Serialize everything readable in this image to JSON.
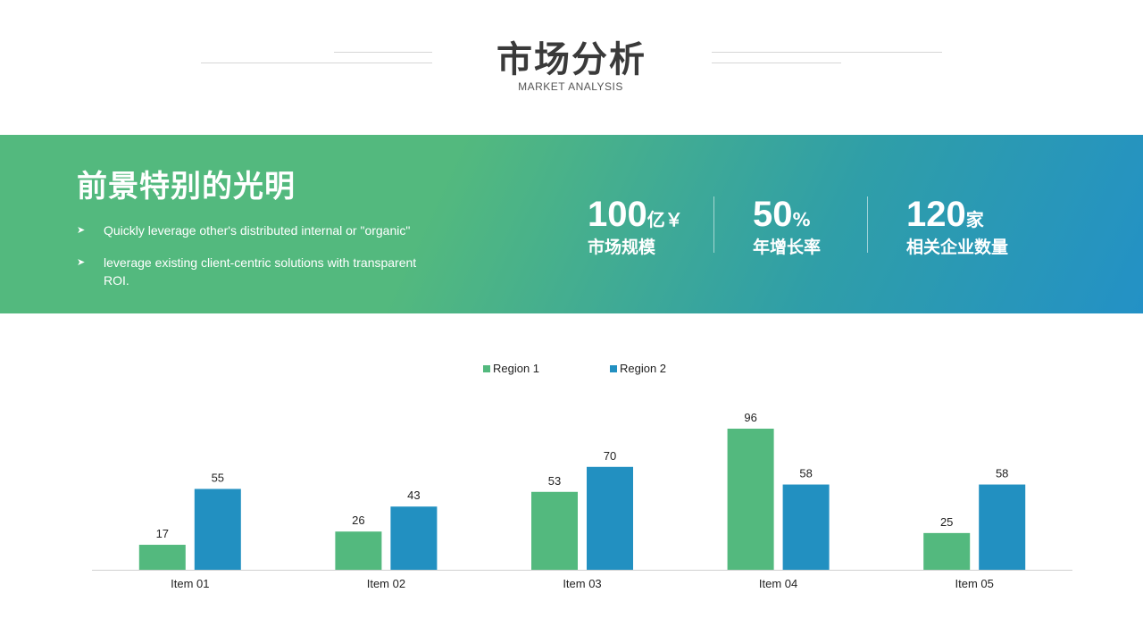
{
  "header": {
    "title": "市场分析",
    "subtitle": "MARKET ANALYSIS"
  },
  "banner": {
    "title": "前景特别的光明",
    "bullets": [
      "Quickly leverage other's distributed internal or \"organic\"",
      "leverage existing client-centric solutions with transparent ROI."
    ],
    "stats": [
      {
        "number": "100",
        "unit": "亿￥",
        "label": "市场规模"
      },
      {
        "number": "50",
        "unit": "%",
        "label": "年增长率"
      },
      {
        "number": "120",
        "unit": "家",
        "label": "相关企业数量"
      }
    ]
  },
  "colors": {
    "region1": "#53b97e",
    "region2": "#2290c1",
    "gradient_start": "#53b97e",
    "gradient_end": "#2391c6"
  },
  "icons": {
    "bullet": "arrowhead-bullet-icon"
  },
  "chart_data": {
    "type": "bar",
    "categories": [
      "Item 01",
      "Item 02",
      "Item 03",
      "Item 04",
      "Item 05"
    ],
    "series": [
      {
        "name": "Region 1",
        "values": [
          17,
          26,
          53,
          96,
          25
        ]
      },
      {
        "name": "Region 2",
        "values": [
          55,
          43,
          70,
          58,
          58
        ]
      }
    ],
    "ylim": [
      0,
      96
    ],
    "legend_position": "top",
    "grid": false,
    "data_labels": true
  }
}
